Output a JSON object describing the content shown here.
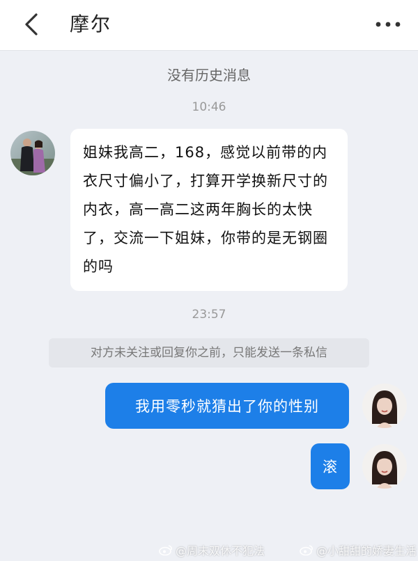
{
  "header": {
    "title": "摩尔",
    "back_icon": "chevron-left-icon",
    "more_icon": "more-dots-icon"
  },
  "chat": {
    "no_history": "没有历史消息",
    "time1": "10:46",
    "incoming_message": "姐妹我高二，168，感觉以前带的内衣尺寸偏小了，打算开学换新尺寸的内衣，高一高二这两年胸长的太快了，交流一下姐妹，你带的是无钢圈的吗",
    "time2": "23:57",
    "notice": "对方未关注或回复你之前，只能发送一条私信",
    "outgoing_message_1": "我用零秒就猜出了你的性别",
    "outgoing_message_2": "滚"
  },
  "watermarks": {
    "left": "@周末双休不犯法",
    "right": "@小甜甜的娇妻生活"
  },
  "colors": {
    "accent_blue": "#1d7fe8",
    "background": "#eef0f5"
  }
}
